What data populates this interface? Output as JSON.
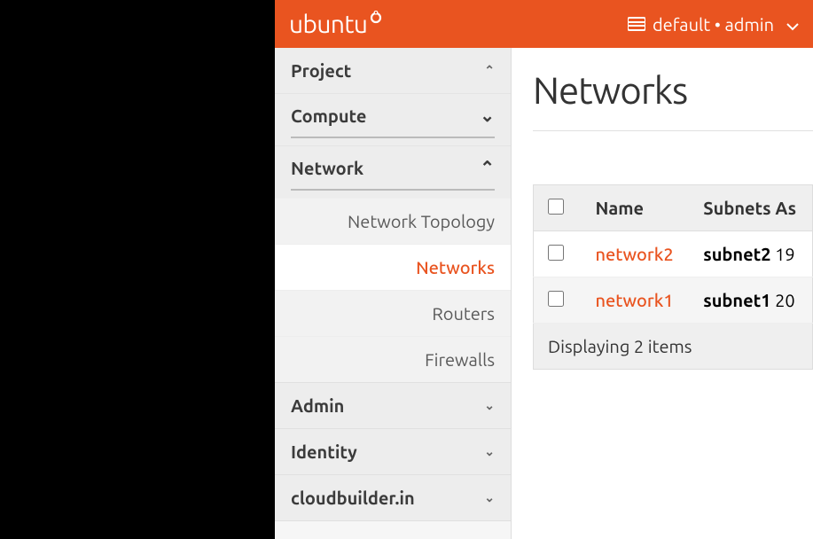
{
  "header": {
    "brand": "ubuntu",
    "context": "default • admin"
  },
  "sidebar": {
    "project_label": "Project",
    "compute_label": "Compute",
    "network_label": "Network",
    "admin_label": "Admin",
    "identity_label": "Identity",
    "cloudbuilder_label": "cloudbuilder.in",
    "items": {
      "network_topology": "Network Topology",
      "networks": "Networks",
      "routers": "Routers",
      "firewalls": "Firewalls"
    }
  },
  "page": {
    "title": "Networks"
  },
  "table": {
    "headers": {
      "name": "Name",
      "subnets": "Subnets As"
    },
    "rows": [
      {
        "name": "network2",
        "subnets_label": "subnet2",
        "subnets_rest": "19"
      },
      {
        "name": "network1",
        "subnets_label": "subnet1",
        "subnets_rest": "20"
      }
    ],
    "footer": "Displaying 2 items"
  }
}
